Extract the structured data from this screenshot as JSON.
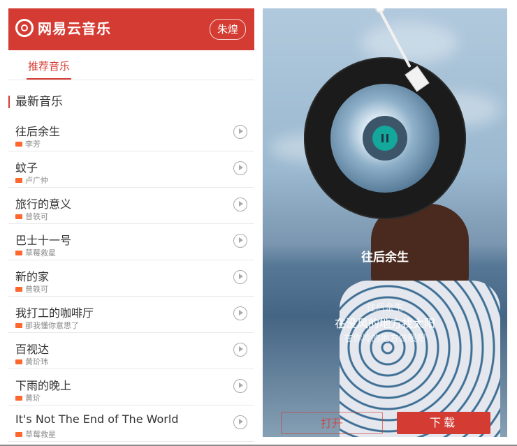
{
  "header": {
    "brand": "网易云音乐",
    "user_button": "朱煌"
  },
  "tabs": [
    "推荐音乐"
  ],
  "section_title": "最新音乐",
  "songs": [
    {
      "title": "往后余生",
      "artist": "李芳"
    },
    {
      "title": "蚊子",
      "artist": "卢广仲"
    },
    {
      "title": "旅行的意义",
      "artist": "曾轶可"
    },
    {
      "title": "巴士十一号",
      "artist": "草莓救星"
    },
    {
      "title": "新的家",
      "artist": "曾轶可"
    },
    {
      "title": "我打工的咖啡厅",
      "artist": "那我懂你意思了"
    },
    {
      "title": "百视达",
      "artist": "黄玠玮"
    },
    {
      "title": "下雨的晚上",
      "artist": "黄玠"
    },
    {
      "title": "It's Not The End of The World",
      "artist": "草莓救星"
    }
  ],
  "player": {
    "song_name": "往后余生",
    "lyric_prev": "往后余生",
    "lyric_current": "在没风的地方找太阳",
    "lyric_next": "在你冷的地方做暖阳",
    "open_button": "打开",
    "download_button": "下载"
  },
  "colors": {
    "accent": "#d43c33",
    "play_green": "#13a89b"
  },
  "icons": [
    "netease-music-logo-icon",
    "play-circle-icon",
    "sq-icon",
    "pause-icon",
    "tonearm-icon"
  ]
}
